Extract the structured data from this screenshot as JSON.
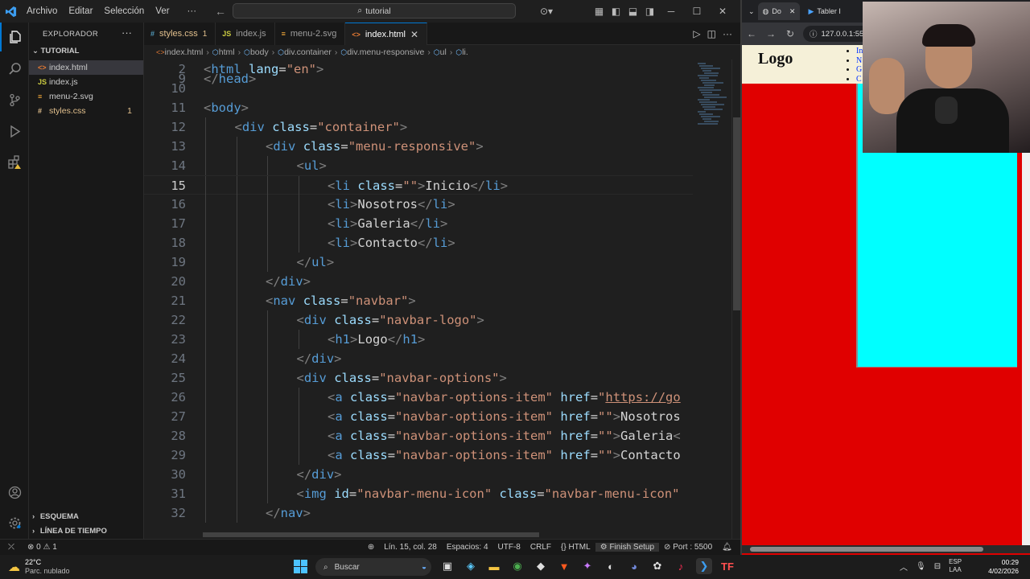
{
  "titlebar": {
    "menus": [
      "Archivo",
      "Editar",
      "Selección",
      "Ver"
    ],
    "search": "tutorial"
  },
  "sidebar": {
    "title": "EXPLORADOR",
    "folder": "TUTORIAL",
    "files": [
      {
        "name": "index.html",
        "icon": "<>",
        "color": "#e37933",
        "selected": true,
        "badge": ""
      },
      {
        "name": "index.js",
        "icon": "JS",
        "color": "#cbcb41",
        "selected": false,
        "badge": ""
      },
      {
        "name": "menu-2.svg",
        "icon": "≡",
        "color": "#ffb13b",
        "selected": false,
        "badge": ""
      },
      {
        "name": "styles.css",
        "icon": "#",
        "color": "#e2c08d",
        "selected": false,
        "badge": "1"
      }
    ],
    "sections": [
      "ESQUEMA",
      "LÍNEA DE TIEMPO"
    ]
  },
  "tabs": [
    {
      "label": "styles.css",
      "icon": "#",
      "icon_color": "#519aba",
      "badge": "1",
      "active": false,
      "label_color": "#e2c08d"
    },
    {
      "label": "index.js",
      "icon": "JS",
      "icon_color": "#cbcb41",
      "badge": "",
      "active": false,
      "label_color": "#9d9d9d"
    },
    {
      "label": "menu-2.svg",
      "icon": "≡",
      "icon_color": "#ffb13b",
      "badge": "",
      "active": false,
      "label_color": "#9d9d9d"
    },
    {
      "label": "index.html",
      "icon": "<>",
      "icon_color": "#e37933",
      "badge": "",
      "active": true,
      "label_color": "#ffffff"
    }
  ],
  "breadcrumb": [
    "index.html",
    "html",
    "body",
    "div.container",
    "div.menu-responsive",
    "ul",
    "li."
  ],
  "code": {
    "current_line": 15,
    "lines": [
      {
        "n": "2",
        "indent": 0,
        "html": "<span class='tag-b'>&lt;</span><span class='tag-n'>html</span> <span class='attr'>lang</span><span class='txt'>=</span><span class='str'>\"en\"</span><span class='tag-b'>&gt;</span>"
      },
      {
        "n": "10",
        "indent": 0,
        "html": ""
      },
      {
        "n": "11",
        "indent": 0,
        "html": "<span class='tag-b'>&lt;</span><span class='tag-n'>body</span><span class='tag-b'>&gt;</span>"
      },
      {
        "n": "12",
        "indent": 1,
        "html": "<span class='tag-b'>&lt;</span><span class='tag-n'>div</span> <span class='attr'>class</span><span class='txt'>=</span><span class='str'>\"container\"</span><span class='tag-b'>&gt;</span>"
      },
      {
        "n": "13",
        "indent": 2,
        "html": "<span class='tag-b'>&lt;</span><span class='tag-n'>div</span> <span class='attr'>class</span><span class='txt'>=</span><span class='str'>\"menu-responsive\"</span><span class='tag-b'>&gt;</span>"
      },
      {
        "n": "14",
        "indent": 3,
        "html": "<span class='tag-b'>&lt;</span><span class='tag-n'>ul</span><span class='tag-b'>&gt;</span>"
      },
      {
        "n": "15",
        "indent": 4,
        "html": "<span class='tag-b'>&lt;</span><span class='tag-n'>li</span> <span class='attr'>class</span><span class='txt'>=</span><span class='str'>\"\"</span><span class='tag-b'>&gt;</span><span class='txt'>Inicio</span><span class='tag-b'>&lt;/</span><span class='tag-n'>li</span><span class='tag-b'>&gt;</span>"
      },
      {
        "n": "16",
        "indent": 4,
        "html": "<span class='tag-b'>&lt;</span><span class='tag-n'>li</span><span class='tag-b'>&gt;</span><span class='txt'>Nosotros</span><span class='tag-b'>&lt;/</span><span class='tag-n'>li</span><span class='tag-b'>&gt;</span>"
      },
      {
        "n": "17",
        "indent": 4,
        "html": "<span class='tag-b'>&lt;</span><span class='tag-n'>li</span><span class='tag-b'>&gt;</span><span class='txt'>Galeria</span><span class='tag-b'>&lt;/</span><span class='tag-n'>li</span><span class='tag-b'>&gt;</span>"
      },
      {
        "n": "18",
        "indent": 4,
        "html": "<span class='tag-b'>&lt;</span><span class='tag-n'>li</span><span class='tag-b'>&gt;</span><span class='txt'>Contacto</span><span class='tag-b'>&lt;/</span><span class='tag-n'>li</span><span class='tag-b'>&gt;</span>"
      },
      {
        "n": "19",
        "indent": 3,
        "html": "<span class='tag-b'>&lt;/</span><span class='tag-n'>ul</span><span class='tag-b'>&gt;</span>"
      },
      {
        "n": "20",
        "indent": 2,
        "html": "<span class='tag-b'>&lt;/</span><span class='tag-n'>div</span><span class='tag-b'>&gt;</span>"
      },
      {
        "n": "21",
        "indent": 2,
        "html": "<span class='tag-b'>&lt;</span><span class='tag-n'>nav</span> <span class='attr'>class</span><span class='txt'>=</span><span class='str'>\"navbar\"</span><span class='tag-b'>&gt;</span>"
      },
      {
        "n": "22",
        "indent": 3,
        "html": "<span class='tag-b'>&lt;</span><span class='tag-n'>div</span> <span class='attr'>class</span><span class='txt'>=</span><span class='str'>\"navbar-logo\"</span><span class='tag-b'>&gt;</span>"
      },
      {
        "n": "23",
        "indent": 4,
        "html": "<span class='tag-b'>&lt;</span><span class='tag-n'>h1</span><span class='tag-b'>&gt;</span><span class='txt'>Logo</span><span class='tag-b'>&lt;/</span><span class='tag-n'>h1</span><span class='tag-b'>&gt;</span>"
      },
      {
        "n": "24",
        "indent": 3,
        "html": "<span class='tag-b'>&lt;/</span><span class='tag-n'>div</span><span class='tag-b'>&gt;</span>"
      },
      {
        "n": "25",
        "indent": 3,
        "html": "<span class='tag-b'>&lt;</span><span class='tag-n'>div</span> <span class='attr'>class</span><span class='txt'>=</span><span class='str'>\"navbar-options\"</span><span class='tag-b'>&gt;</span>"
      },
      {
        "n": "26",
        "indent": 4,
        "html": "<span class='tag-b'>&lt;</span><span class='tag-n'>a</span> <span class='attr'>class</span><span class='txt'>=</span><span class='str'>\"navbar-options-item\"</span> <span class='attr'>href</span><span class='txt'>=</span><span class='str'>\"<u>https://go</u></span>"
      },
      {
        "n": "27",
        "indent": 4,
        "html": "<span class='tag-b'>&lt;</span><span class='tag-n'>a</span> <span class='attr'>class</span><span class='txt'>=</span><span class='str'>\"navbar-options-item\"</span> <span class='attr'>href</span><span class='txt'>=</span><span class='str'>\"\"</span><span class='tag-b'>&gt;</span><span class='txt'>Nosotros</span>"
      },
      {
        "n": "28",
        "indent": 4,
        "html": "<span class='tag-b'>&lt;</span><span class='tag-n'>a</span> <span class='attr'>class</span><span class='txt'>=</span><span class='str'>\"navbar-options-item\"</span> <span class='attr'>href</span><span class='txt'>=</span><span class='str'>\"\"</span><span class='tag-b'>&gt;</span><span class='txt'>Galeria</span><span class='tag-b'>&lt;</span>"
      },
      {
        "n": "29",
        "indent": 4,
        "html": "<span class='tag-b'>&lt;</span><span class='tag-n'>a</span> <span class='attr'>class</span><span class='txt'>=</span><span class='str'>\"navbar-options-item\"</span> <span class='attr'>href</span><span class='txt'>=</span><span class='str'>\"\"</span><span class='tag-b'>&gt;</span><span class='txt'>Contacto</span>"
      },
      {
        "n": "30",
        "indent": 3,
        "html": "<span class='tag-b'>&lt;/</span><span class='tag-n'>div</span><span class='tag-b'>&gt;</span>"
      },
      {
        "n": "31",
        "indent": 3,
        "html": "<span class='tag-b'>&lt;</span><span class='tag-n'>img</span> <span class='attr'>id</span><span class='txt'>=</span><span class='str'>\"navbar-menu-icon\"</span> <span class='attr'>class</span><span class='txt'>=</span><span class='str'>\"navbar-menu-icon\"</span>"
      },
      {
        "n": "32",
        "indent": 2,
        "html": "<span class='tag-b'>&lt;/</span><span class='tag-n'>nav</span><span class='tag-b'>&gt;</span>"
      }
    ]
  },
  "statusbar": {
    "errors": "0",
    "warnings": "1",
    "position": "Lín. 15, col. 28",
    "spaces": "Espacios: 4",
    "encoding": "UTF-8",
    "eol": "CRLF",
    "language": "HTML",
    "finish_setup": "Finish Setup",
    "port": "Port : 5500"
  },
  "browser": {
    "tabs": [
      "Do",
      "Tabler I"
    ],
    "url": "127.0.0.1:55",
    "page_logo": "Logo",
    "menu_items": [
      "In",
      "N",
      "G",
      "C"
    ]
  },
  "taskbar": {
    "temperature": "22°C",
    "weather": "Parc. nublado",
    "search": "Buscar",
    "lang_top": "ESP",
    "lang_bottom": "LAA",
    "time": "00:29",
    "date": "4/02/2026"
  }
}
